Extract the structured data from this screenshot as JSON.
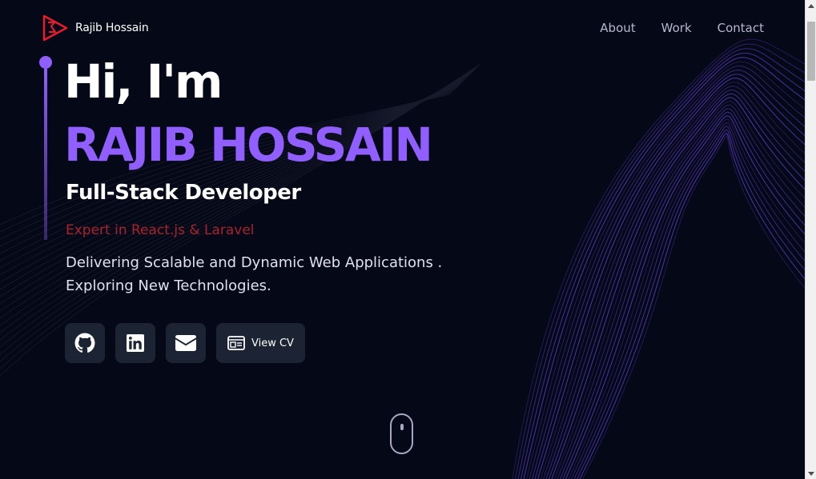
{
  "brand": {
    "name": "Rajib Hossain",
    "accent": "#e11d2e"
  },
  "nav": {
    "items": [
      "About",
      "Work",
      "Contact"
    ]
  },
  "hero": {
    "greeting": "Hi, I'm",
    "name": "RAJIB HOSSAIN",
    "role": "Full-Stack Developer",
    "expertise": "Expert in React.js & Laravel",
    "tagline_line1": "Delivering Scalable and Dynamic Web Applications .",
    "tagline_line2": "Exploring New Technologies."
  },
  "actions": {
    "github_icon": "github-icon",
    "linkedin_icon": "linkedin-icon",
    "email_icon": "email-icon",
    "cv_label": "View CV"
  },
  "colors": {
    "background": "#050816",
    "primary": "#915eff",
    "secondary_text": "#aaa6c3",
    "expertise_text": "#a8232f",
    "button_bg": "#1c2333"
  }
}
